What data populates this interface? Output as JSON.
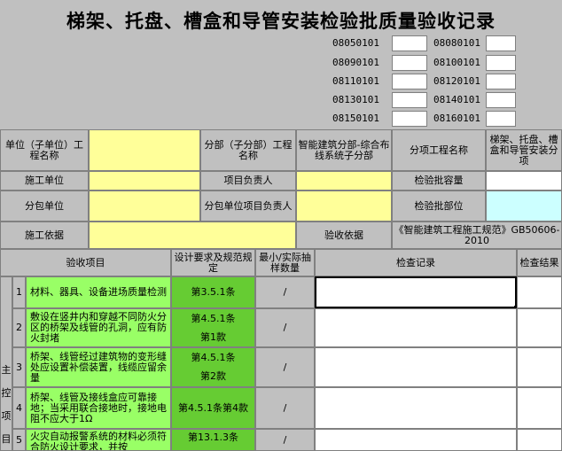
{
  "title": "梯架、托盘、槽盒和导管安装检验批质量验收记录",
  "codes": [
    {
      "left": "08050101",
      "right": "08080101"
    },
    {
      "left": "08090101",
      "right": "08100101"
    },
    {
      "left": "08110101",
      "right": "08120101"
    },
    {
      "left": "08130101",
      "right": "08140101"
    },
    {
      "left": "08150101",
      "right": "08160101"
    }
  ],
  "info": {
    "unit_label": "单位（子单位）工程名称",
    "division_label": "分部（子分部）工程名称",
    "division_value": "智能建筑分部-综合布线系统子分部",
    "subitem_label": "分项工程名称",
    "subitem_value": "梯架、托盘、槽盒和导管安装分项",
    "builder_label": "施工单位",
    "pm_label": "项目负责人",
    "capacity_label": "检验批容量",
    "sub_label": "分包单位",
    "sub_pm_label": "分包单位项目负责人",
    "location_label": "检验批部位",
    "basis_label": "施工依据",
    "accept_basis_label": "验收依据",
    "accept_basis_value": "《智能建筑工程施工规范》GB50606-2010"
  },
  "table": {
    "headers": {
      "item": "验收项目",
      "req": "设计要求及规范规定",
      "min": "最小/实际抽样数量",
      "record": "检查记录",
      "result": "检查结果"
    },
    "group_label": "主控项目",
    "rows": [
      {
        "no": "1",
        "desc": "材料、器具、设备进场质量检测",
        "clause": "第3.5.1条",
        "clause2": "",
        "slash": "/"
      },
      {
        "no": "2",
        "desc": "敷设在竖井内和穿越不同防火分区的桥架及线管的孔洞，应有防火封堵",
        "clause": "第4.5.1条",
        "clause2": "第1款",
        "slash": "/"
      },
      {
        "no": "3",
        "desc": "桥架、线管经过建筑物的变形缝处应设置补偿装置，线缆应留余量",
        "clause": "第4.5.1条",
        "clause2": "第2款",
        "slash": "/"
      },
      {
        "no": "4",
        "desc": "桥架、线管及接线盒应可靠接地；当采用联合接地时，接地电阻不应大于1Ω",
        "clause": "第4.5.1条第4款",
        "clause2": "",
        "slash": "/"
      },
      {
        "no": "5",
        "desc": "火灾自动报警系统的材料必须符合防火设计要求，并按",
        "clause": "第13.1.3条",
        "clause2": "",
        "slash": "/"
      }
    ]
  }
}
